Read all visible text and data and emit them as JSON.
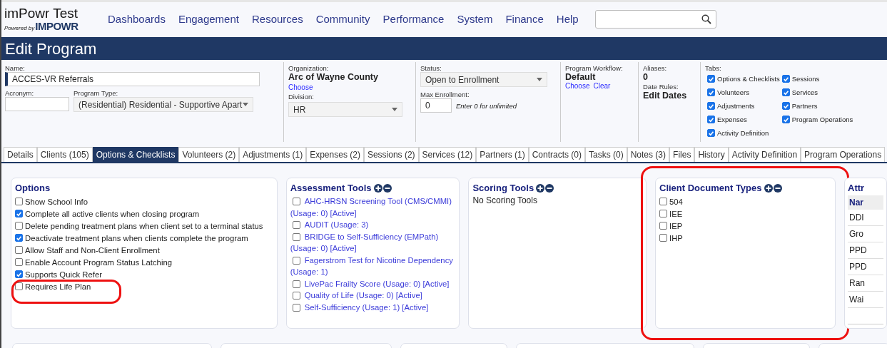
{
  "app": {
    "title": "imPowr Test",
    "powered_by": "Powered by",
    "brand": "IMPOWR"
  },
  "nav": [
    "Dashboards",
    "Engagement",
    "Resources",
    "Community",
    "Performance",
    "System",
    "Finance",
    "Help"
  ],
  "page_title": "Edit Program",
  "form": {
    "name": {
      "label": "Name:",
      "value": "ACCES-VR Referrals"
    },
    "acronym": {
      "label": "Acronym:"
    },
    "program_type": {
      "label": "Program Type:",
      "value": "(Residential) Residential - Supportive Apart"
    },
    "organization": {
      "label": "Organization:",
      "value": "Arc of Wayne County",
      "link": "Choose"
    },
    "division": {
      "label": "Division:",
      "value": "HR"
    },
    "status": {
      "label": "Status:",
      "value": "Open to Enrollment"
    },
    "max_enrollment": {
      "label": "Max Enrollment:",
      "value": "0",
      "hint": "Enter 0 for unlimited"
    },
    "workflow": {
      "label": "Program Workflow:",
      "value": "Default",
      "links": [
        "Choose",
        "Clear"
      ]
    },
    "aliases": {
      "label": "Aliases:",
      "value": "0"
    },
    "date_rules": {
      "label": "Date Rules:",
      "value": "Edit Dates"
    },
    "tab_settings": {
      "label": "Tabs:",
      "columns": [
        [
          {
            "label": "Options & Checklists",
            "checked": true
          },
          {
            "label": "Volunteers",
            "checked": true
          },
          {
            "label": "Adjustments",
            "checked": true
          },
          {
            "label": "Expenses",
            "checked": true
          },
          {
            "label": "Activity Definition",
            "checked": true
          }
        ],
        [
          {
            "label": "Sessions",
            "checked": true
          },
          {
            "label": "Services",
            "checked": true
          },
          {
            "label": "Partners",
            "checked": true
          },
          {
            "label": "Program Operations",
            "checked": true
          }
        ]
      ]
    }
  },
  "tabs": [
    {
      "label": "Details",
      "selected": false
    },
    {
      "label": "Clients (105)",
      "selected": false
    },
    {
      "label": "Options & Checklists",
      "selected": true
    },
    {
      "label": "Volunteers (2)",
      "selected": false
    },
    {
      "label": "Adjustments (1)",
      "selected": false
    },
    {
      "label": "Expenses (2)",
      "selected": false
    },
    {
      "label": "Sessions (2)",
      "selected": false
    },
    {
      "label": "Services (12)",
      "selected": false
    },
    {
      "label": "Partners (1)",
      "selected": false
    },
    {
      "label": "Contracts (0)",
      "selected": false
    },
    {
      "label": "Tasks (0)",
      "selected": false
    },
    {
      "label": "Notes (3)",
      "selected": false
    },
    {
      "label": "Files",
      "selected": false
    },
    {
      "label": "History",
      "selected": false
    },
    {
      "label": "Activity Definition",
      "selected": false
    },
    {
      "label": "Program Operations",
      "selected": false
    }
  ],
  "options": {
    "title": "Options",
    "items": [
      {
        "label": "Show School Info",
        "checked": false
      },
      {
        "label": "Complete all active clients when closing program",
        "checked": true
      },
      {
        "label": "Delete pending treatment plans when client set to a terminal status",
        "checked": false
      },
      {
        "label": "Deactivate treatment plans when clients complete the program",
        "checked": true
      },
      {
        "label": "Allow Staff and Non-Client Enrollment",
        "checked": false
      },
      {
        "label": "Enable Account Program Status Latching",
        "checked": false
      },
      {
        "label": "Supports Quick Refer",
        "checked": true
      },
      {
        "label": "Requires Life Plan",
        "checked": false
      }
    ]
  },
  "assessment_tools": {
    "title": "Assessment Tools",
    "items": [
      {
        "label": "AHC-HRSN Screening Tool (CMS/CMMI) (Usage: 0) [Active]",
        "checked": false
      },
      {
        "label": "AUDIT (Usage: 3)",
        "checked": false
      },
      {
        "label": "BRIDGE to Self-Sufficiency (EMPath) (Usage: 0) [Active]",
        "checked": false
      },
      {
        "label": "Fagerstrom Test for Nicotine Dependency (Usage: 1)",
        "checked": false
      },
      {
        "label": "LivePac Frailty Score (Usage: 0) [Active]",
        "checked": false
      },
      {
        "label": "Quality of Life (Usage: 0) [Active]",
        "checked": false
      },
      {
        "label": "Self-Sufficiency (Usage: 1) [Active]",
        "checked": false
      }
    ]
  },
  "scoring_tools": {
    "title": "Scoring Tools",
    "empty_text": "No Scoring Tools"
  },
  "client_document_types": {
    "title": "Client Document Types",
    "items": [
      {
        "label": "504",
        "checked": false
      },
      {
        "label": "IEE",
        "checked": false
      },
      {
        "label": "IEP",
        "checked": false
      },
      {
        "label": "IHP",
        "checked": false
      }
    ]
  },
  "attributes": {
    "title": "Attr",
    "column_1": "Nar",
    "rows": [
      "DDI",
      "Gro",
      "PPD",
      "PPD",
      "Ran",
      "Wai"
    ]
  }
}
